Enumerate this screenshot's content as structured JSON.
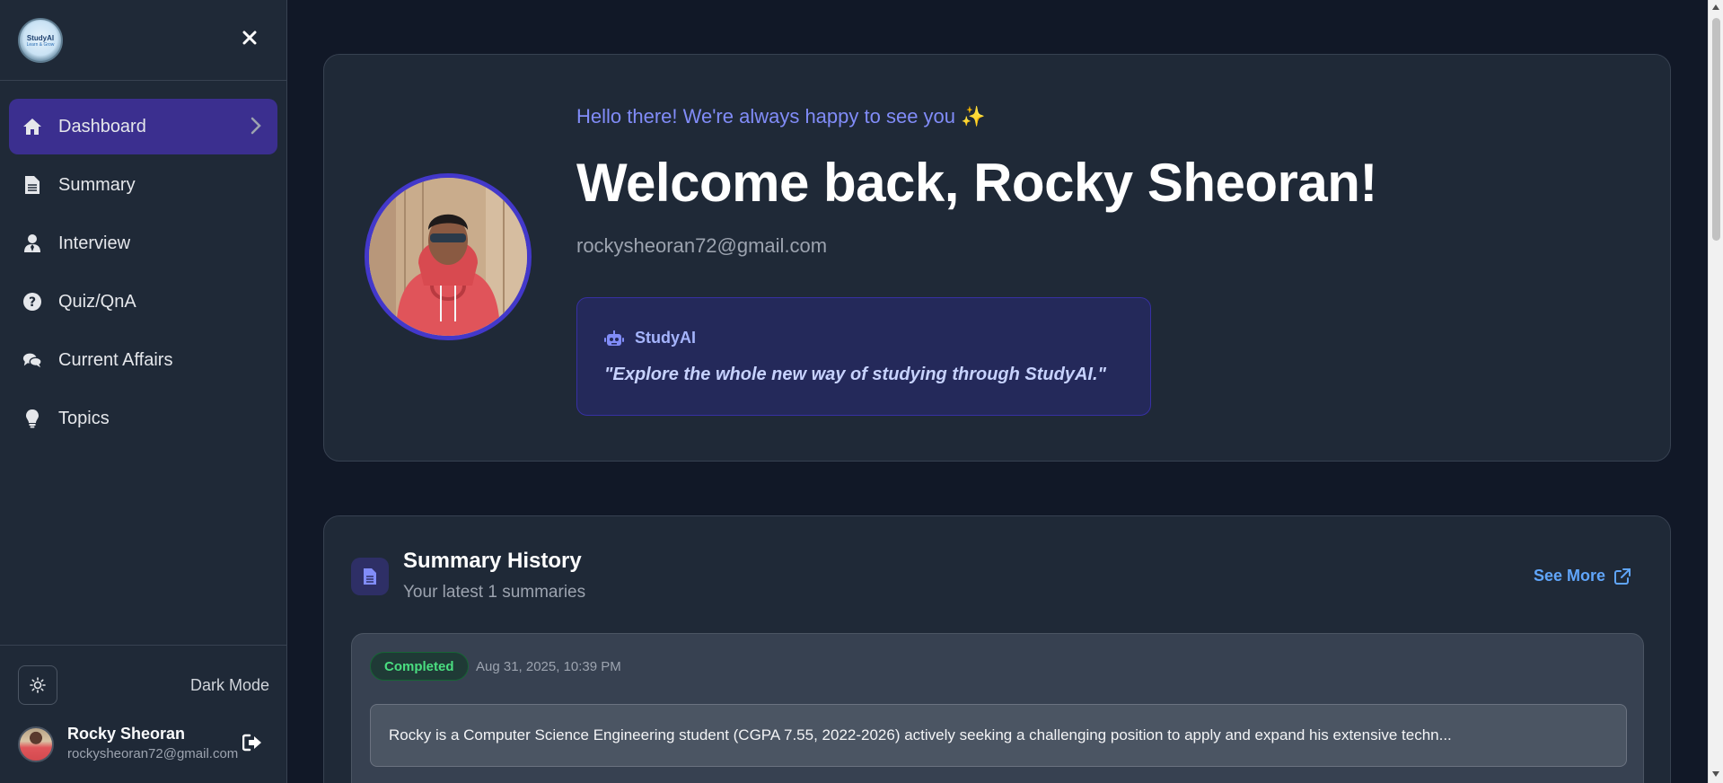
{
  "sidebar": {
    "logo_text": "StudyAI",
    "logo_subtext": "Learn & Grow",
    "items": [
      {
        "label": "Dashboard",
        "icon": "home-icon",
        "active": true
      },
      {
        "label": "Summary",
        "icon": "file-text-icon",
        "active": false
      },
      {
        "label": "Interview",
        "icon": "user-tie-icon",
        "active": false
      },
      {
        "label": "Quiz/QnA",
        "icon": "question-circle-icon",
        "active": false
      },
      {
        "label": "Current Affairs",
        "icon": "comments-icon",
        "active": false
      },
      {
        "label": "Topics",
        "icon": "lightbulb-icon",
        "active": false
      }
    ],
    "theme_label": "Dark Mode",
    "user": {
      "name": "Rocky Sheoran",
      "email": "rockysheoran72@gmail.com"
    }
  },
  "hero": {
    "greeting": "Hello there! We're always happy to see you ✨",
    "welcome": "Welcome back, Rocky Sheoran!",
    "email": "rockysheoran72@gmail.com",
    "quote_brand": "StudyAI",
    "quote": "\"Explore the whole new way of studying through StudyAI.\""
  },
  "summary": {
    "title": "Summary History",
    "subtitle": "Your latest 1 summaries",
    "see_more": "See More",
    "entries": [
      {
        "status": "Completed",
        "date": "Aug 31, 2025, 10:39 PM",
        "text": "Rocky is a Computer Science Engineering student (CGPA 7.55, 2022-2026) actively seeking a challenging position to apply and expand his extensive techn..."
      }
    ]
  },
  "colors": {
    "accent": "#3b2f8f",
    "link": "#60a5fa",
    "success": "#4ade80",
    "background": "#111827",
    "panel": "#1f2937"
  }
}
